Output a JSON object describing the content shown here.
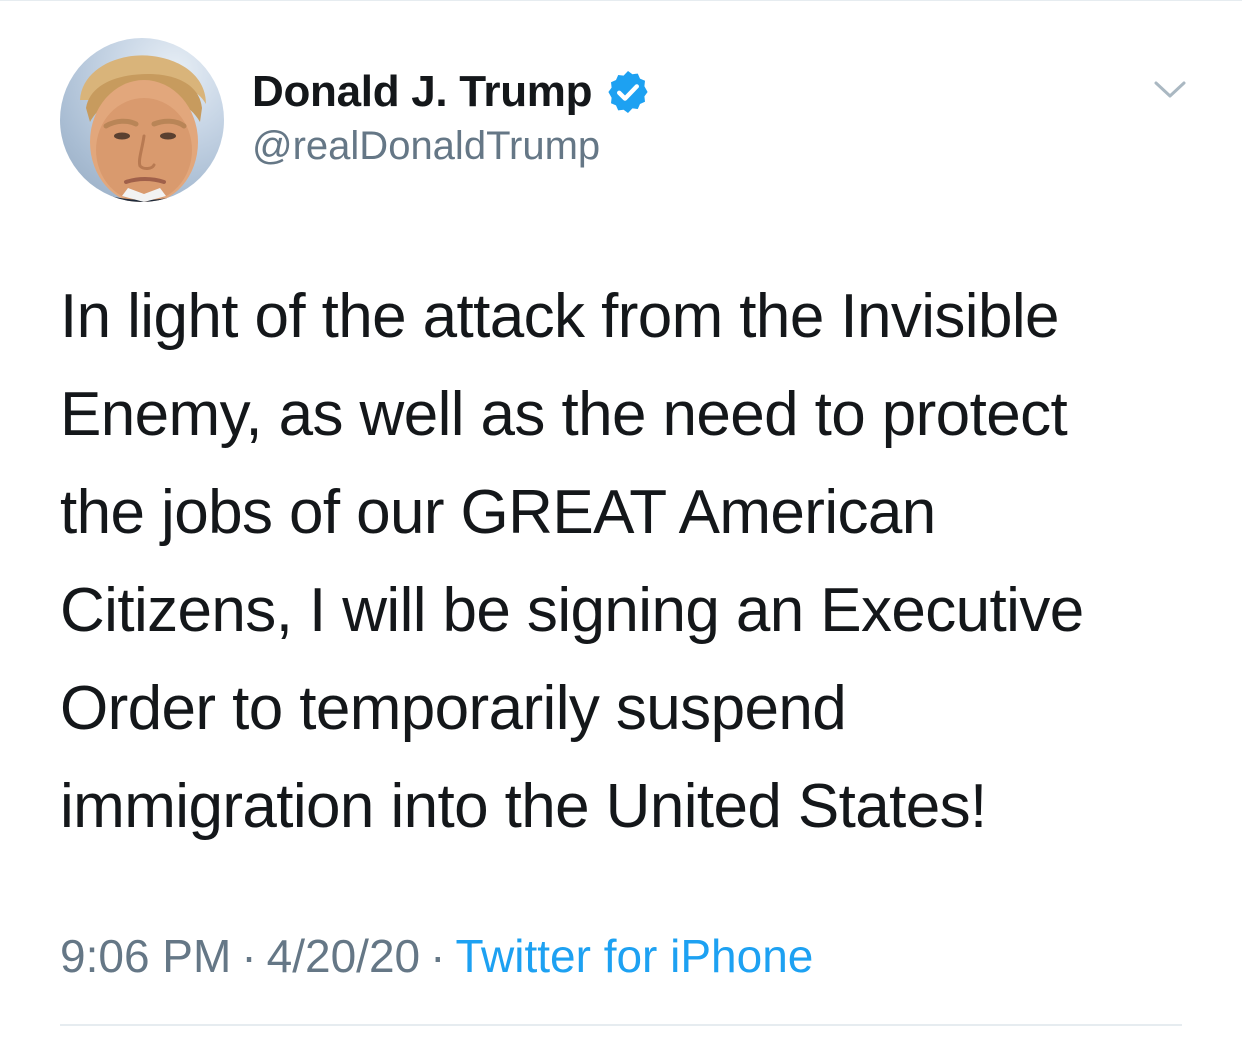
{
  "author": {
    "name": "Donald J. Trump",
    "handle": "@realDonaldTrump",
    "verified": true,
    "verified_color": "#1da1f2"
  },
  "tweet": {
    "text": "In light of the attack from the Invisible\nEnemy, as well as the need to protect\nthe jobs of our GREAT American\nCitizens, I will be signing an Executive\nOrder to temporarily suspend\nimmigration into the United States!"
  },
  "meta": {
    "time": "9:06 PM",
    "separator": "·",
    "date": "4/20/20",
    "source": "Twitter for iPhone"
  },
  "icons": {
    "verified": "verified-badge-icon",
    "more": "chevron-down-icon"
  },
  "colors": {
    "text": "#14171a",
    "secondary": "#657786",
    "accent": "#1da1f2",
    "divider": "#e6ecf0"
  }
}
